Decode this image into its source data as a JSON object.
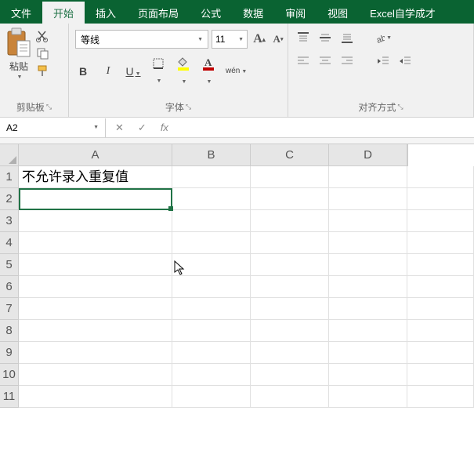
{
  "tabs": {
    "file": "文件",
    "home": "开始",
    "insert": "插入",
    "layout": "页面布局",
    "formula": "公式",
    "data": "数据",
    "review": "审阅",
    "view": "视图",
    "help": "Excel自学成才"
  },
  "clipboard": {
    "paste": "粘贴",
    "label": "剪贴板"
  },
  "font": {
    "name": "等线",
    "size": "11",
    "label": "字体",
    "bold": "B",
    "italic": "I",
    "underline": "U",
    "wen": "wén"
  },
  "align": {
    "label": "对齐方式"
  },
  "namebox": {
    "ref": "A2",
    "fx": "fx"
  },
  "cols": [
    "A",
    "B",
    "C",
    "D"
  ],
  "rows": [
    "1",
    "2",
    "3",
    "4",
    "5",
    "6",
    "7",
    "8",
    "9",
    "10",
    "11"
  ],
  "cells": {
    "A1": "不允许录入重复值"
  },
  "colors": {
    "accent": "#0a6332",
    "fill": "#ffff00",
    "font": "#c00000"
  }
}
